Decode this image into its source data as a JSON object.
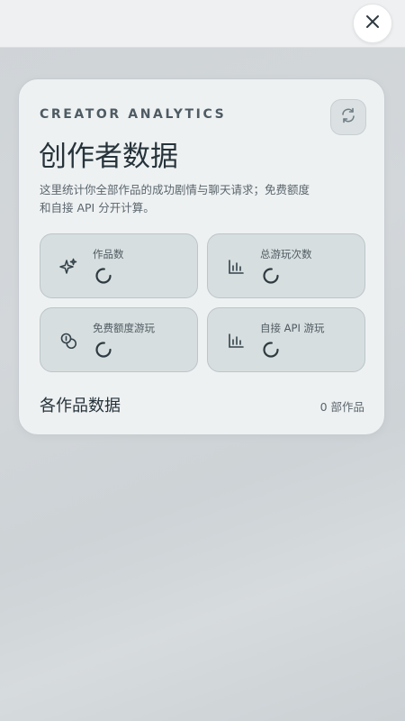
{
  "header": {
    "close_icon": "close-icon"
  },
  "analytics": {
    "eyebrow": "CREATOR ANALYTICS",
    "title": "创作者数据",
    "description": "这里统计你全部作品的成功剧情与聊天请求；免费额度和自接 API 分开计算。",
    "refresh_icon": "refresh-icon",
    "stats": [
      {
        "label": "作品数",
        "icon": "sparkles-icon",
        "state": "loading"
      },
      {
        "label": "总游玩次数",
        "icon": "bar-chart-icon",
        "state": "loading"
      },
      {
        "label": "免费额度游玩",
        "icon": "coins-icon",
        "state": "loading"
      },
      {
        "label": "自接 API 游玩",
        "icon": "bar-chart-icon",
        "state": "loading"
      }
    ],
    "works_section": {
      "title": "各作品数据",
      "count": "0 部作品"
    }
  },
  "colors": {
    "accent_text": "#26333a",
    "muted_text": "#5a666d",
    "stat_bg": "#d7dedf",
    "card_bg": "#eef1f2"
  }
}
